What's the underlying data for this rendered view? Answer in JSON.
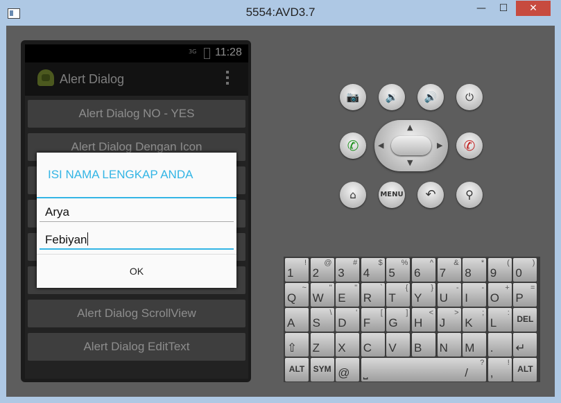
{
  "window": {
    "title": "5554:AVD3.7",
    "minimize": "—",
    "maximize": "☐",
    "close": "✕"
  },
  "status": {
    "time": "11:28",
    "signal": "3G"
  },
  "app": {
    "title": "Alert Dialog"
  },
  "buttons": {
    "b0": "Alert Dialog NO - YES",
    "b1": "Alert Dialog Dengan Icon",
    "b5": "Alert Dialog ScrollView",
    "b6": "Alert Dialog EditText"
  },
  "dialog": {
    "title": "ISI NAMA LENGKAP ANDA",
    "first_name": "Arya",
    "last_name": "Febiyan",
    "ok": "OK"
  },
  "hardware": {
    "menu": "MENU"
  },
  "keyboard": {
    "r0": [
      [
        "1",
        "!"
      ],
      [
        "2",
        "@"
      ],
      [
        "3",
        "#"
      ],
      [
        "4",
        "$"
      ],
      [
        "5",
        "%"
      ],
      [
        "6",
        "^"
      ],
      [
        "7",
        "&"
      ],
      [
        "8",
        "*"
      ],
      [
        "9",
        "("
      ],
      [
        "0",
        ")"
      ]
    ],
    "r1": [
      [
        "Q",
        "~"
      ],
      [
        "W",
        "\""
      ],
      [
        "E",
        "\""
      ],
      [
        "R",
        "`"
      ],
      [
        "T",
        "{"
      ],
      [
        "Y",
        "}"
      ],
      [
        "U",
        "-"
      ],
      [
        "I",
        "-"
      ],
      [
        "O",
        "+"
      ],
      [
        "P",
        "="
      ]
    ],
    "r2": [
      [
        "A",
        ""
      ],
      [
        "S",
        "\\"
      ],
      [
        "D",
        "'"
      ],
      [
        "F",
        "["
      ],
      [
        "G",
        "]"
      ],
      [
        "H",
        "<"
      ],
      [
        "J",
        ">"
      ],
      [
        "K",
        ";"
      ],
      [
        "L",
        ":"
      ]
    ],
    "r3": [
      [
        "Z",
        ""
      ],
      [
        "X",
        ""
      ],
      [
        "C",
        ""
      ],
      [
        "V",
        ""
      ],
      [
        "B",
        ""
      ],
      [
        "N",
        ""
      ],
      [
        "M",
        ""
      ],
      [
        ".",
        ""
      ]
    ],
    "r4": [
      [
        "@",
        ""
      ],
      [
        "/",
        "?"
      ],
      [
        ",",
        "!"
      ]
    ],
    "alt": "ALT",
    "sym": "SYM",
    "del": "DEL"
  }
}
